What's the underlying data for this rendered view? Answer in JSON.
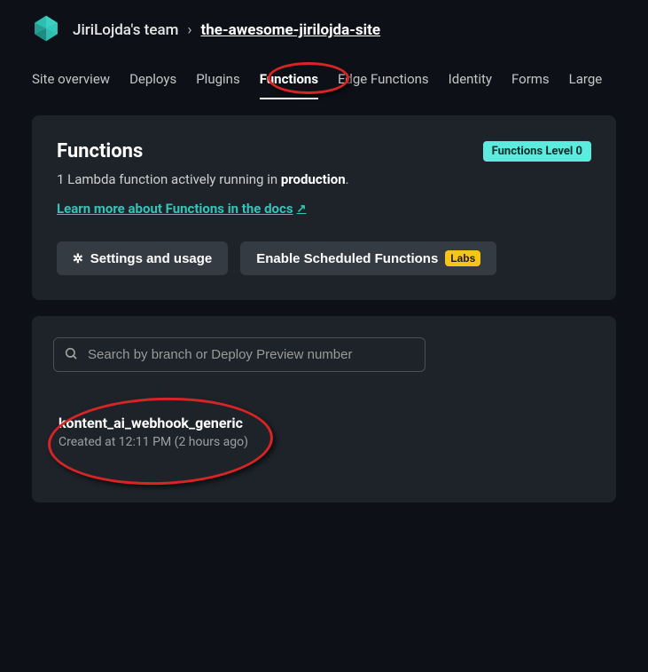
{
  "breadcrumb": {
    "team": "JiriLojda's team",
    "separator": "›",
    "site": "the-awesome-jirilojda-site"
  },
  "tabs": {
    "overview": "Site overview",
    "deploys": "Deploys",
    "plugins": "Plugins",
    "functions": "Functions",
    "edge_functions": "Edge Functions",
    "identity": "Identity",
    "forms": "Forms",
    "large": "Large"
  },
  "functions_card": {
    "title": "Functions",
    "count_prefix": "1 Lambda function actively running in ",
    "env": "production",
    "period": ".",
    "learn_link": "Learn more about Functions in the docs",
    "arrow": "↗",
    "level_badge": "Functions Level 0",
    "settings_btn": "Settings and usage",
    "scheduled_btn": "Enable Scheduled Functions",
    "labs_badge": "Labs"
  },
  "search": {
    "placeholder": "Search by branch or Deploy Preview number"
  },
  "function_item": {
    "name": "kontent_ai_webhook_generic",
    "meta": "Created at 12:11 PM (2 hours ago)"
  }
}
